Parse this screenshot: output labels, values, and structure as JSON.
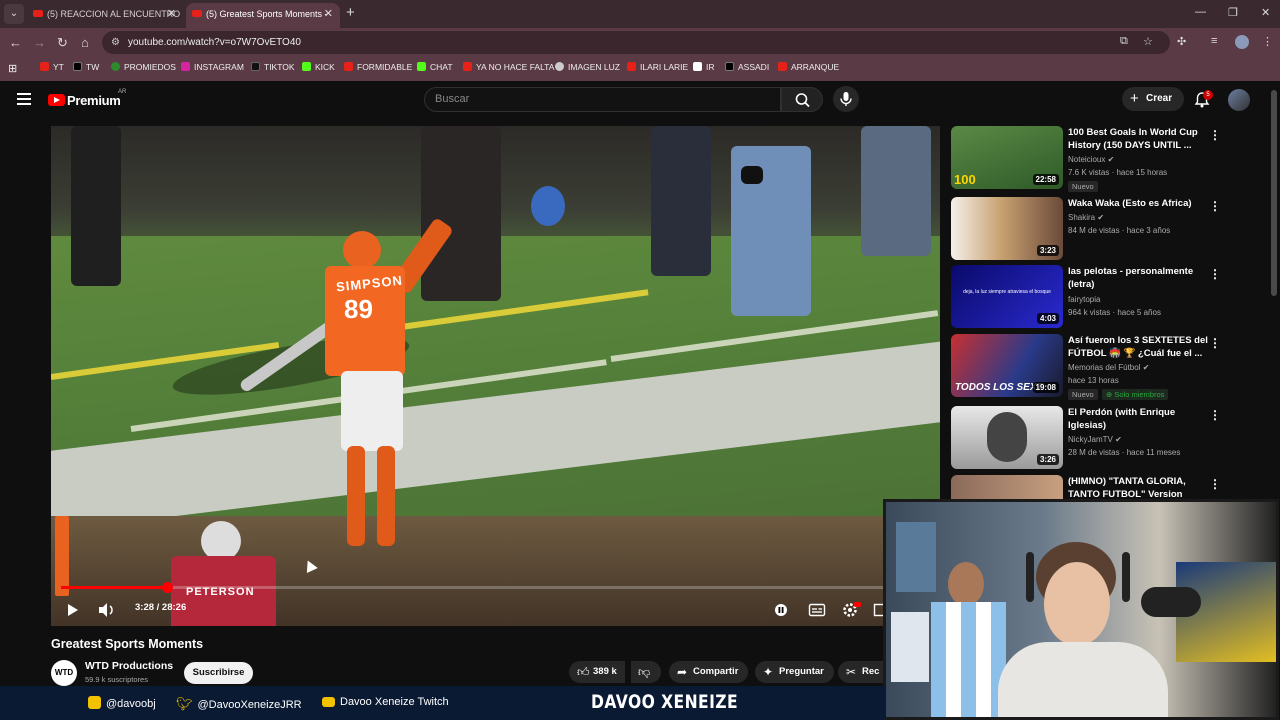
{
  "browser": {
    "tabs": [
      {
        "title": "(5) REACCION AL ENCUENTRO"
      },
      {
        "title": "(5) Greatest Sports Moments -"
      }
    ],
    "url": "youtube.com/watch?v=o7W7OvETO40",
    "bookmarks": [
      "YT",
      "TW",
      "PROMIEDOS",
      "INSTAGRAM",
      "TIKTOK",
      "KICK",
      "FORMIDABLE",
      "CHAT",
      "YA NO HACE FALTA",
      "IMAGEN LUZ",
      "ILARI LARIE",
      "IR",
      "ASSADI",
      "ARRANQUE"
    ]
  },
  "youtube": {
    "logo_text": "Premium",
    "logo_region": "AR",
    "search_placeholder": "Buscar",
    "create_label": "Crear",
    "notification_count": "5"
  },
  "player": {
    "time_current": "3:28",
    "time_total": "28:26",
    "time_display": "3:28 / 28:26",
    "progress_fraction": 0.122,
    "jersey_name": "SIMPSON",
    "jersey_number": "89",
    "back_jersey_name": "PETERSON"
  },
  "video": {
    "title": "Greatest Sports Moments",
    "channel_name": "WTD Productions",
    "channel_avatar_text": "WTD",
    "subscribers": "59.9 k suscriptores",
    "subscribe_label": "Suscribirse",
    "likes": "389 k",
    "share_label": "Compartir",
    "ask_label": "Preguntar",
    "recortar_label": "Rec"
  },
  "recommendations": [
    {
      "title": "100 Best Goals In World Cup History (150 DAYS UNTIL ...",
      "channel": "Noteicioux",
      "meta": "7.6 K vistas · hace 15 horas",
      "duration": "22:58",
      "badge": "Nuevo",
      "thumb_text": "100",
      "thumb_color": "#3f7a2e"
    },
    {
      "title": "Waka Waka (Esto es Africa)",
      "channel": "Shakira",
      "meta": "84 M de vistas · hace 3 años",
      "duration": "3:23",
      "thumb_color": "#6a4a3a"
    },
    {
      "title": "las pelotas - personalmente (letra)",
      "channel": "fairytopia",
      "meta": "964 k vistas · hace 5 años",
      "duration": "4:03",
      "thumb_text": "deja, la luz siempre atraviesa el bosque",
      "thumb_color": "#1a1aa0"
    },
    {
      "title": "Así fueron los 3 SEXTETES del FÚTBOL 🏟️ 🏆 ¿Cuál fue el ...",
      "channel": "Memorias del Fútbol",
      "meta": "hace 13 horas",
      "duration": "19:08",
      "badge": "Nuevo",
      "badge2": "Solo miembros",
      "thumb_text": "TODOS LOS SEXT",
      "thumb_color": "#2a3a5a"
    },
    {
      "title": "El Perdón (with Enrique Iglesias)",
      "channel": "NickyJamTV",
      "meta": "28 M de vistas · hace 11 meses",
      "duration": "3:26",
      "thumb_color": "#d8d8d8"
    },
    {
      "title": "(HIMNO) \"TANTA GLORIA, TANTO FUTBOL\" Version 2023...",
      "thumb_color": "#7a5a4a"
    }
  ],
  "stream": {
    "instagram": "@davoobj",
    "twitter": "@DavooXeneizeJRR",
    "twitch": "Davoo Xeneize Twitch",
    "brand": "DAVOO XENEIZE"
  },
  "colors": {
    "youtube_red": "#ff0000",
    "tab_bar": "#3a2a30",
    "address_bar": "#5a3a44",
    "stream_bar": "#0b1a33",
    "new_badge_green": "#2ba640"
  }
}
